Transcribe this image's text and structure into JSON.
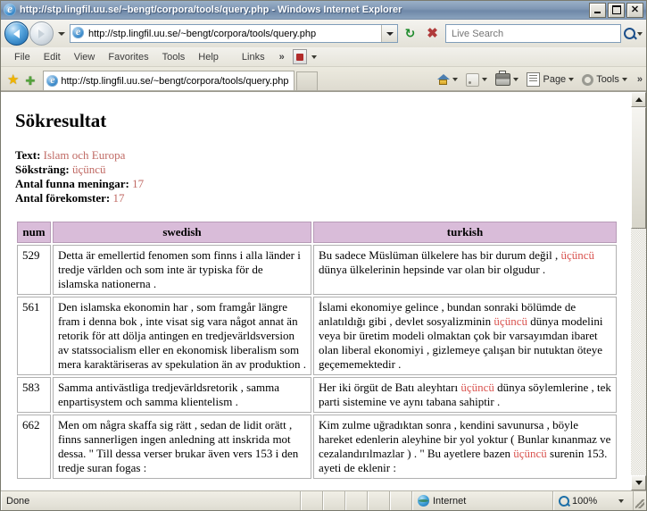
{
  "window": {
    "title": "http://stp.lingfil.uu.se/~bengt/corpora/tools/query.php - Windows Internet Explorer",
    "minimize_label": "",
    "maximize_label": "",
    "close_label": "✕"
  },
  "nav": {
    "address_value": "http://stp.lingfil.uu.se/~bengt/corpora/tools/query.php",
    "search_placeholder": "Live Search",
    "search_value": ""
  },
  "menu": {
    "items": [
      "File",
      "Edit",
      "View",
      "Favorites",
      "Tools",
      "Help"
    ],
    "links_label": "Links",
    "overflow_label": "»"
  },
  "tabs": {
    "active_title": "http://stp.lingfil.uu.se/~bengt/corpora/tools/query.php"
  },
  "toolbar_right": {
    "page_label": "Page",
    "tools_label": "Tools",
    "overflow_label": "»"
  },
  "page": {
    "heading": "Sökresultat",
    "meta": [
      {
        "label": "Text:",
        "value": "Islam och Europa"
      },
      {
        "label": "Söksträng:",
        "value": "üçüncü"
      },
      {
        "label": "Antal funna meningar:",
        "value": "17"
      },
      {
        "label": "Antal förekomster:",
        "value": "17"
      }
    ],
    "table": {
      "columns": [
        "num",
        "swedish",
        "turkish"
      ],
      "rows": [
        {
          "num": "529",
          "swedish": [
            {
              "t": "Detta är emellertid fenomen som finns i alla länder i tredje världen och som inte är typiska för de islamska nationerna ."
            }
          ],
          "turkish": [
            {
              "t": "Bu sadece Müslüman ülkelere has bir durum değil , "
            },
            {
              "t": "üçüncü",
              "hl": true
            },
            {
              "t": " dünya ülkelerinin hepsinde var olan bir olgudur ."
            }
          ]
        },
        {
          "num": "561",
          "swedish": [
            {
              "t": "Den islamska ekonomin har , som framgår längre fram i denna bok , inte visat sig vara något annat än retorik för att dölja antingen en tredjevärldsversion av statssocialism eller en ekonomisk liberalism som mera karaktäriseras av spekulation än av produktion ."
            }
          ],
          "turkish": [
            {
              "t": "İslami ekonomiye gelince , bundan sonraki bölümde de anlatıldığı gibi , devlet sosyalizminin "
            },
            {
              "t": "üçüncü",
              "hl": true
            },
            {
              "t": " dünya modelini veya bir üretim modeli olmaktan çok bir varsayımdan ibaret olan liberal ekonomiyi , gizlemeye çalışan bir nutuktan öteye geçememektedir ."
            }
          ]
        },
        {
          "num": "583",
          "swedish": [
            {
              "t": "Samma antivästliga tredjevärldsretorik , samma enpartisystem och samma klientelism ."
            }
          ],
          "turkish": [
            {
              "t": "Her iki örgüt de Batı aleyhtarı "
            },
            {
              "t": "üçüncü",
              "hl": true
            },
            {
              "t": " dünya söylemlerine , tek parti sistemine ve aynı tabana sahiptir ."
            }
          ]
        },
        {
          "num": "662",
          "swedish": [
            {
              "t": "Men om några skaffa sig rätt , sedan de lidit orätt , finns sannerligen ingen anledning att inskrida mot dessa. \" Till dessa verser brukar även vers 153 i den tredje suran fogas :"
            }
          ],
          "turkish": [
            {
              "t": "Kim zulme uğradıktan sonra , kendini savunursa , böyle hareket edenlerin aleyhine bir yol yoktur ( Bunlar kınanmaz ve cezalandırılmazlar ) . \" Bu ayetlere bazen "
            },
            {
              "t": "üçüncü",
              "hl": true
            },
            {
              "t": " surenin 153. ayeti de eklenir :"
            }
          ]
        }
      ]
    }
  },
  "status": {
    "text": "Done",
    "zone": "Internet",
    "zoom": "100%"
  },
  "colors": {
    "table_header_bg": "#d9bcd9",
    "highlight": "#d9534f",
    "meta_value": "#c06a64",
    "titlebar": "#7f97b4"
  }
}
